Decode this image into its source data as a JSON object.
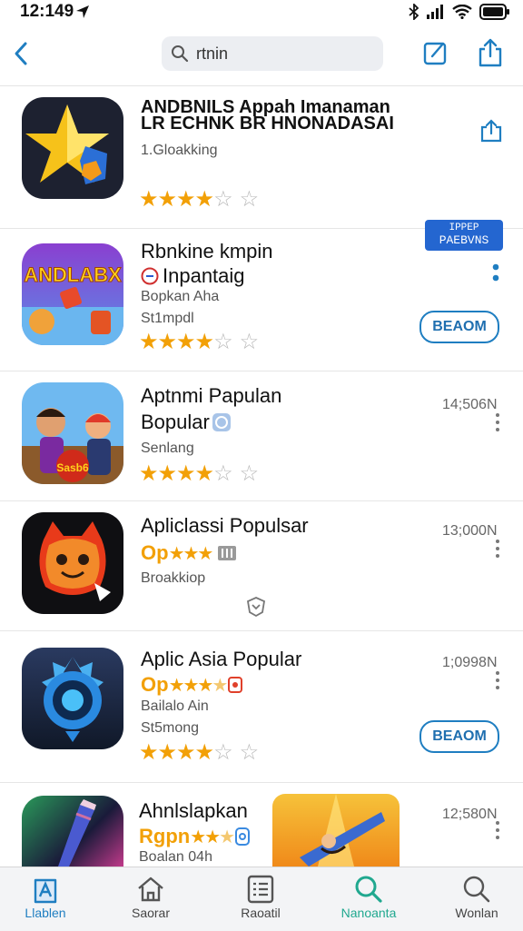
{
  "status": {
    "time": "12:149"
  },
  "search": {
    "value": "rtnin"
  },
  "colors": {
    "accent": "#1f7ec1",
    "star": "#f2a007",
    "tab_active": "#20a88f"
  },
  "apps": [
    {
      "title_line1": "ANDBNILS    Appah  Imanaman",
      "title_line2": "LR ECHNK  BR HNONADASAI",
      "subtitle": "1.Gloakking"
    },
    {
      "title_line1": "Rbnkine kmpin",
      "title_line2": "Inpantaig",
      "subtitle": "Bopkan Aha",
      "subtitle2": "St1mpdl",
      "badge_line1": "IPPEP",
      "badge_line2": "PAEBVNS",
      "button": "BEAOM",
      "icon_text": "ANDLABX"
    },
    {
      "title_line1": "Aptnmi Papulan",
      "title_line2": "Bopular",
      "subtitle": "Senlang",
      "size": "14;506N",
      "icon_text": "Sasb6"
    },
    {
      "title_line1": "Apliclassi Populsar",
      "title_line2": "Op",
      "subtitle": "Broakkiop",
      "size": "13;000N"
    },
    {
      "title_line1": "Aplic Asia Popular",
      "title_line2": "Op",
      "subtitle": "Bailalo Ain",
      "subtitle2": "St5mong",
      "size": "1;0998N",
      "button": "BEAOM"
    },
    {
      "title_line1": "Ahnlslapkan",
      "title_line2": "Rgpn",
      "subtitle": "Boalan 04h",
      "size": "12;580N"
    }
  ],
  "tabs": [
    {
      "label": "Llablen"
    },
    {
      "label": "Saorar"
    },
    {
      "label": "Raoatil"
    },
    {
      "label": "Nanoanta"
    },
    {
      "label": "Wonlan"
    }
  ]
}
